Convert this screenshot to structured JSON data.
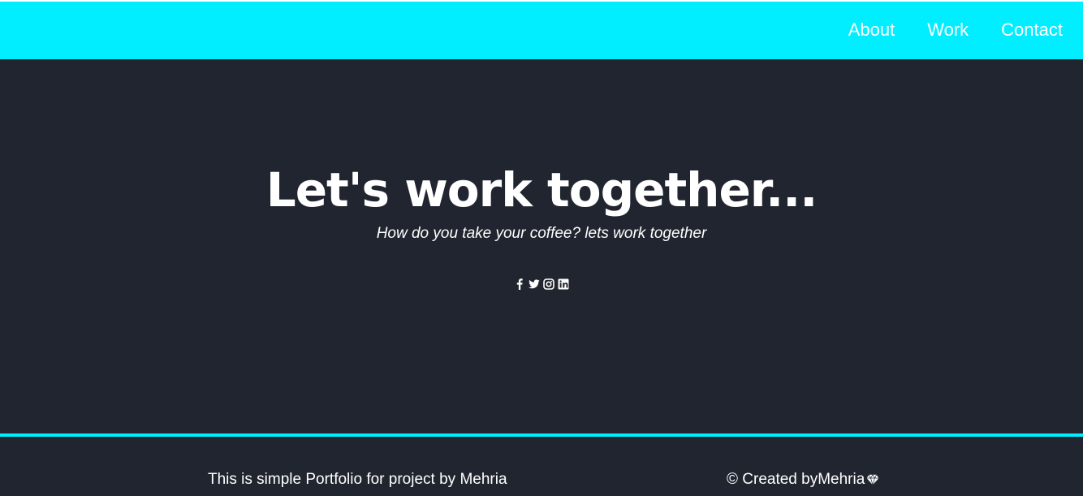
{
  "colors": {
    "accent": "#00eeff",
    "background": "#21252f",
    "text": "#ffffff"
  },
  "nav": {
    "items": [
      {
        "label": "About"
      },
      {
        "label": "Work"
      },
      {
        "label": "Contact"
      }
    ]
  },
  "hero": {
    "title": "Let's work together...",
    "subtitle": "How do you take your coffee? lets work together",
    "socials": [
      {
        "icon": "facebook-icon"
      },
      {
        "icon": "twitter-icon"
      },
      {
        "icon": "instagram-icon"
      },
      {
        "icon": "linkedin-icon"
      }
    ]
  },
  "footer": {
    "left_text": "This is simple Portfolio for project by Mehria",
    "right_text": "© Created byMehria",
    "right_icon": "gem-icon"
  }
}
